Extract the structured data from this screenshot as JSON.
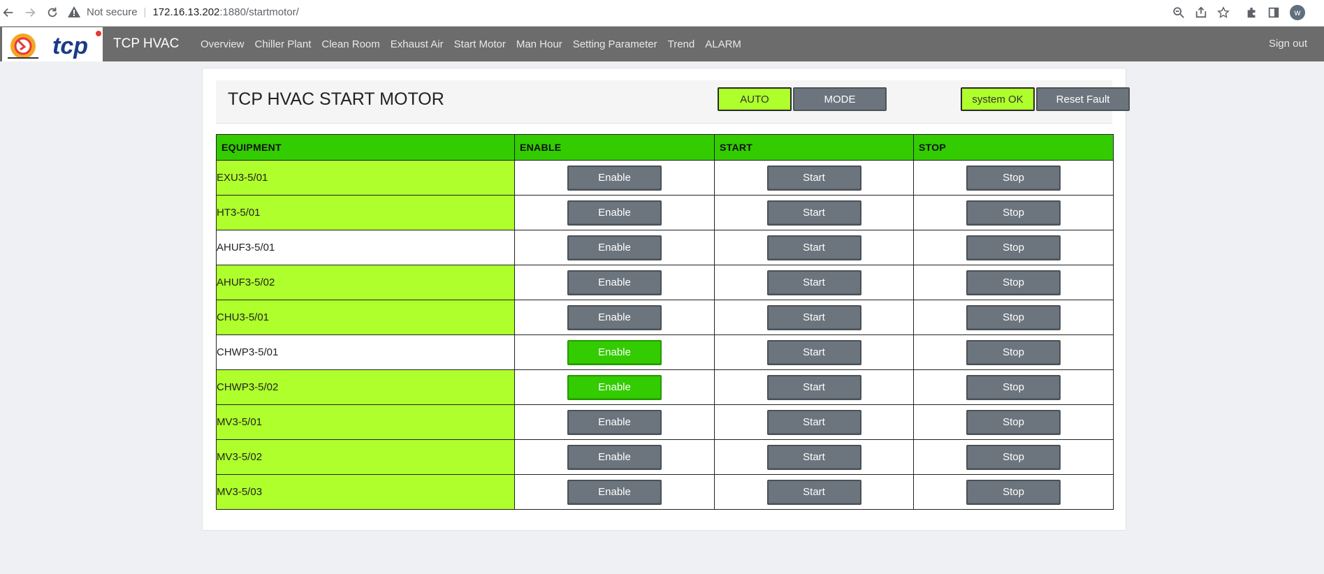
{
  "browser": {
    "not_secure_label": "Not secure",
    "url_host": "172.16.13.202",
    "url_path": ":1880/startmotor/",
    "profile_initial": "w"
  },
  "navbar": {
    "brand": "TCP HVAC",
    "logo_text": "tcp",
    "links": [
      "Overview",
      "Chiller Plant",
      "Clean Room",
      "Exhaust Air",
      "Start Motor",
      "Man Hour",
      "Setting Parameter",
      "Trend",
      "ALARM"
    ],
    "sign_out": "Sign out"
  },
  "header": {
    "title": "TCP HVAC START MOTOR",
    "auto_label": "AUTO",
    "mode_label": "MODE",
    "status_label": "system OK",
    "reset_label": "Reset Fault"
  },
  "table": {
    "columns": [
      "EQUIPMENT",
      "ENABLE",
      "START",
      "STOP"
    ],
    "enable_label": "Enable",
    "start_label": "Start",
    "stop_label": "Stop",
    "colors": {
      "lime": "#aeff2b",
      "header_green": "#33cc00",
      "button_gray": "#6c757d",
      "enabled_green": "#33cc00"
    },
    "rows": [
      {
        "name": "EXU3-5/01",
        "highlight": true,
        "enabled": false
      },
      {
        "name": "HT3-5/01",
        "highlight": true,
        "enabled": false
      },
      {
        "name": "AHUF3-5/01",
        "highlight": false,
        "enabled": false
      },
      {
        "name": "AHUF3-5/02",
        "highlight": true,
        "enabled": false
      },
      {
        "name": "CHU3-5/01",
        "highlight": true,
        "enabled": false
      },
      {
        "name": "CHWP3-5/01",
        "highlight": false,
        "enabled": true
      },
      {
        "name": "CHWP3-5/02",
        "highlight": true,
        "enabled": true
      },
      {
        "name": "MV3-5/01",
        "highlight": true,
        "enabled": false
      },
      {
        "name": "MV3-5/02",
        "highlight": true,
        "enabled": false
      },
      {
        "name": "MV3-5/03",
        "highlight": true,
        "enabled": false
      }
    ]
  }
}
